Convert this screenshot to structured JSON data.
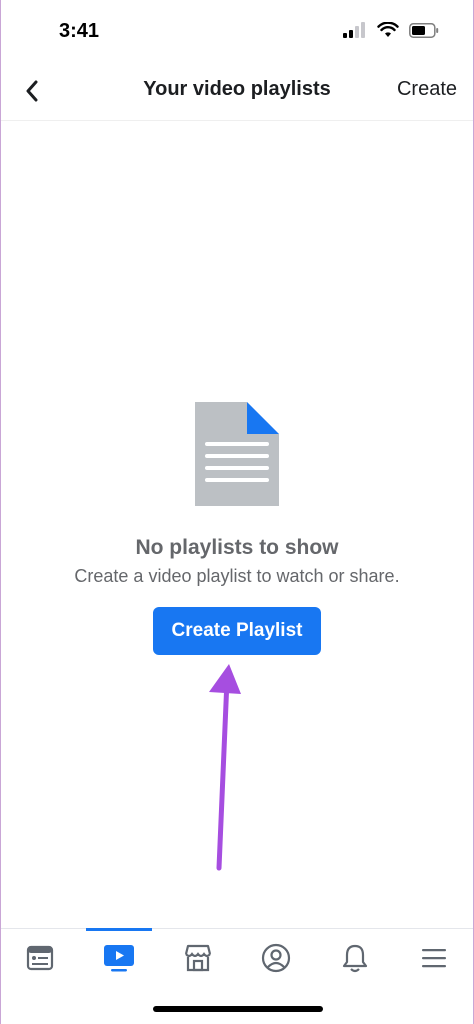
{
  "status_bar": {
    "time": "3:41",
    "icons": [
      "signal-icon",
      "wifi-icon",
      "battery-icon"
    ]
  },
  "header": {
    "title": "Your video playlists",
    "create_label": "Create",
    "back_icon": "chevron-left-icon"
  },
  "empty_state": {
    "illustration": "document-icon",
    "title": "No playlists to show",
    "subtitle": "Create a video playlist to watch or share.",
    "button_label": "Create Playlist"
  },
  "tab_bar": {
    "active_tab": "video",
    "tabs": [
      {
        "id": "news-feed",
        "icon": "news-feed-icon"
      },
      {
        "id": "video",
        "icon": "video-icon"
      },
      {
        "id": "marketplace",
        "icon": "marketplace-icon"
      },
      {
        "id": "profile",
        "icon": "profile-icon"
      },
      {
        "id": "notifications",
        "icon": "bell-icon"
      },
      {
        "id": "menu",
        "icon": "menu-icon"
      }
    ]
  },
  "colors": {
    "accent": "#1877f2",
    "text_secondary": "#65676b",
    "annotation_arrow": "#a64ee0",
    "illustration_gray": "#bcc0c4"
  }
}
